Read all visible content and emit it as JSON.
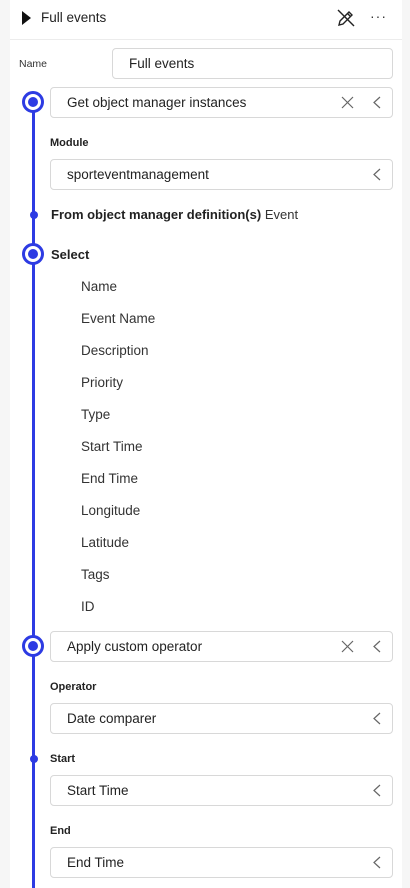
{
  "header": {
    "title": "Full events",
    "more_label": "···"
  },
  "name_field": {
    "label": "Name",
    "value": "Full events"
  },
  "steps": {
    "get_instances": {
      "label": "Get object manager instances"
    },
    "module": {
      "label": "Module",
      "value": "sporteventmanagement"
    },
    "from_definition": {
      "label": "From object manager definition(s)",
      "value": "Event"
    },
    "select": {
      "label": "Select",
      "fields": [
        "Name",
        "Event Name",
        "Description",
        "Priority",
        "Type",
        "Start Time",
        "End Time",
        "Longitude",
        "Latitude",
        "Tags",
        "ID"
      ]
    },
    "custom_operator": {
      "label": "Apply custom operator"
    },
    "operator": {
      "label": "Operator",
      "value": "Date comparer"
    },
    "start": {
      "label": "Start",
      "value": "Start Time"
    },
    "end": {
      "label": "End",
      "value": "End Time"
    }
  },
  "colors": {
    "accent": "#2d3be3",
    "border": "#d8d8d8"
  }
}
